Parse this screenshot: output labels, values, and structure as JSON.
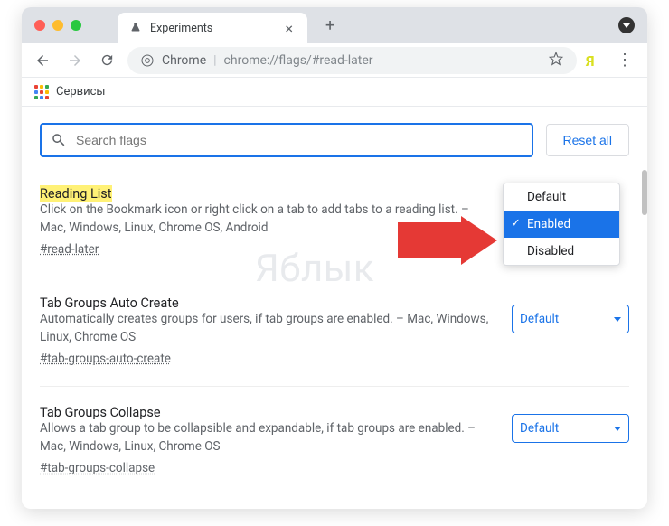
{
  "window": {
    "tab_title": "Experiments",
    "url_label_chrome": "Chrome",
    "url_path": "chrome://flags/#read-later"
  },
  "bookmarks_bar": {
    "apps_label": "Сервисы"
  },
  "apps_colors": [
    "#ea4335",
    "#fbbc04",
    "#34a853",
    "#4285f4",
    "#ea4335",
    "#fbbc04",
    "#34a853",
    "#4285f4",
    "#ea4335"
  ],
  "search": {
    "placeholder": "Search flags",
    "reset_label": "Reset all"
  },
  "dropdown": {
    "options": [
      "Default",
      "Enabled",
      "Disabled"
    ],
    "selected_index": 1
  },
  "flags": [
    {
      "title": "Reading List",
      "highlighted": true,
      "desc": "Click on the Bookmark icon or right click on a tab to add tabs to a reading list. – Mac, Windows, Linux, Chrome OS, Android",
      "anchor": "#read-later",
      "select_value": ""
    },
    {
      "title": "Tab Groups Auto Create",
      "highlighted": false,
      "desc": "Automatically creates groups for users, if tab groups are enabled. – Mac, Windows, Linux, Chrome OS",
      "anchor": "#tab-groups-auto-create",
      "select_value": "Default"
    },
    {
      "title": "Tab Groups Collapse",
      "highlighted": false,
      "desc": "Allows a tab group to be collapsible and expandable, if tab groups are enabled. – Mac, Windows, Linux, Chrome OS",
      "anchor": "#tab-groups-collapse",
      "select_value": "Default"
    }
  ],
  "watermark": "Яблык"
}
